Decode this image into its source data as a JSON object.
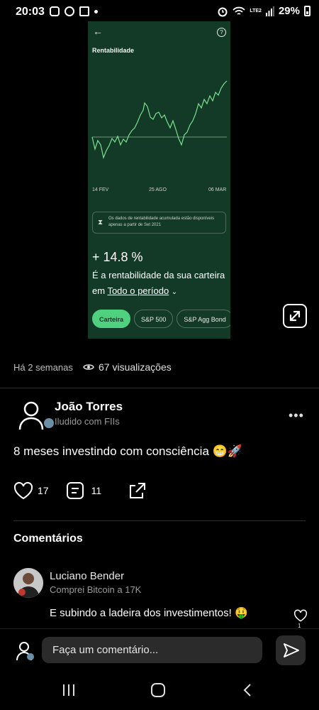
{
  "status_bar": {
    "time": "20:03",
    "battery": "29%",
    "network_label": "LTE2"
  },
  "embedded_screenshot": {
    "title": "Rentabilidade",
    "x_ticks": [
      "14 FEV",
      "25 AGO",
      "06 MAR"
    ],
    "info_text": "Os dados de rentabilidade acumulada estão disponíveis apenas a partir de Set 2021",
    "return_value": "+ 14.8 %",
    "description_prefix": "É a rentabilidade da sua carteira em ",
    "period_link": "Todo o período",
    "chips": [
      "Carteira",
      "S&P 500",
      "S&P Agg Bond"
    ],
    "active_chip": "Carteira",
    "line_color": "#7be08f",
    "bg_color": "#133a26"
  },
  "post": {
    "time_ago": "Há 2 semanas",
    "views": "67 visualizações",
    "author_name": "João Torres",
    "author_badge": "Iludido com FIIs",
    "text": "8 meses investindo com consciência 😁🚀",
    "likes": "17",
    "comments": "11"
  },
  "comments": {
    "title": "Comentários",
    "items": [
      {
        "name": "Luciano Bender",
        "badge": "Comprei Bitcoin a 17K",
        "text": "E subindo a ladeira dos investimentos! 🤑",
        "likes": "1"
      }
    ]
  },
  "composer": {
    "placeholder": "Faça um comentário..."
  }
}
